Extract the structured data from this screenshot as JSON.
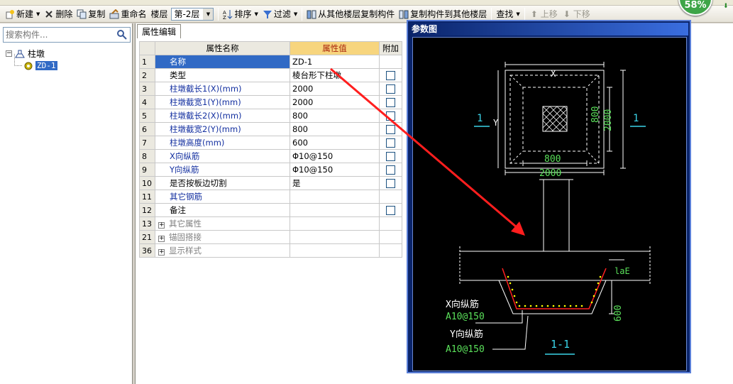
{
  "toolbar": {
    "new_label": "新建",
    "delete_label": "删除",
    "copy_label": "复制",
    "rename_label": "重命名",
    "floor_label": "楼层",
    "floor_value": "第-2层",
    "sort_label": "排序",
    "filter_label": "过滤",
    "copy_from_floor_label": "从其他楼层复制构件",
    "copy_to_floor_label": "复制构件到其他楼层",
    "find_label": "查找",
    "move_up_label": "上移",
    "move_down_label": "下移"
  },
  "badge": {
    "percent": "58%",
    "color": "#3ea548"
  },
  "left_panel": {
    "search_placeholder": "搜索构件...",
    "tree": {
      "root_label": "柱墩",
      "child_label": "ZD-1"
    }
  },
  "properties": {
    "tab_label": "属性编辑",
    "headers": {
      "name": "属性名称",
      "value": "属性值",
      "extra": "附加"
    },
    "rows": [
      {
        "idx": "1",
        "name": "名称",
        "value": "ZD-1",
        "checkbox": false,
        "selected": true
      },
      {
        "idx": "2",
        "name": "类型",
        "value": "棱台形下柱墩",
        "checkbox": true
      },
      {
        "idx": "3",
        "name": "柱墩截长1(X)(mm)",
        "value": "2000",
        "checkbox": true
      },
      {
        "idx": "4",
        "name": "柱墩截宽1(Y)(mm)",
        "value": "2000",
        "checkbox": true
      },
      {
        "idx": "5",
        "name": "柱墩截长2(X)(mm)",
        "value": "800",
        "checkbox": true
      },
      {
        "idx": "6",
        "name": "柱墩截宽2(Y)(mm)",
        "value": "800",
        "checkbox": true
      },
      {
        "idx": "7",
        "name": "柱墩高度(mm)",
        "value": "600",
        "checkbox": true
      },
      {
        "idx": "8",
        "name": "X向纵筋",
        "value": "Φ10@150",
        "checkbox": true
      },
      {
        "idx": "9",
        "name": "Y向纵筋",
        "value": "Φ10@150",
        "checkbox": true
      },
      {
        "idx": "10",
        "name": "是否按板边切割",
        "value": "是",
        "checkbox": true
      },
      {
        "idx": "11",
        "name": "其它钢筋",
        "value": "",
        "checkbox": false
      },
      {
        "idx": "12",
        "name": "备注",
        "value": "",
        "checkbox": true
      },
      {
        "idx": "13",
        "name": "其它属性",
        "value": "",
        "checkbox": false,
        "group": true
      },
      {
        "idx": "21",
        "name": "锚固搭接",
        "value": "",
        "checkbox": false,
        "group": true
      },
      {
        "idx": "36",
        "name": "显示样式",
        "value": "",
        "checkbox": false,
        "group": true
      }
    ]
  },
  "reference": {
    "title": "参数图",
    "plan": {
      "x_label": "X",
      "y_label": "Y",
      "inner_width": "800",
      "inner_height": "800",
      "outer_width": "2000",
      "outer_height": "2000",
      "section_mark": "1"
    },
    "section": {
      "lae_label": "laE",
      "height_label": "600",
      "x_bar_label": "X向纵筋",
      "x_bar_spec": "A10@150",
      "y_bar_label": "Y向纵筋",
      "y_bar_spec": "A10@150",
      "section_title": "1-1"
    }
  }
}
